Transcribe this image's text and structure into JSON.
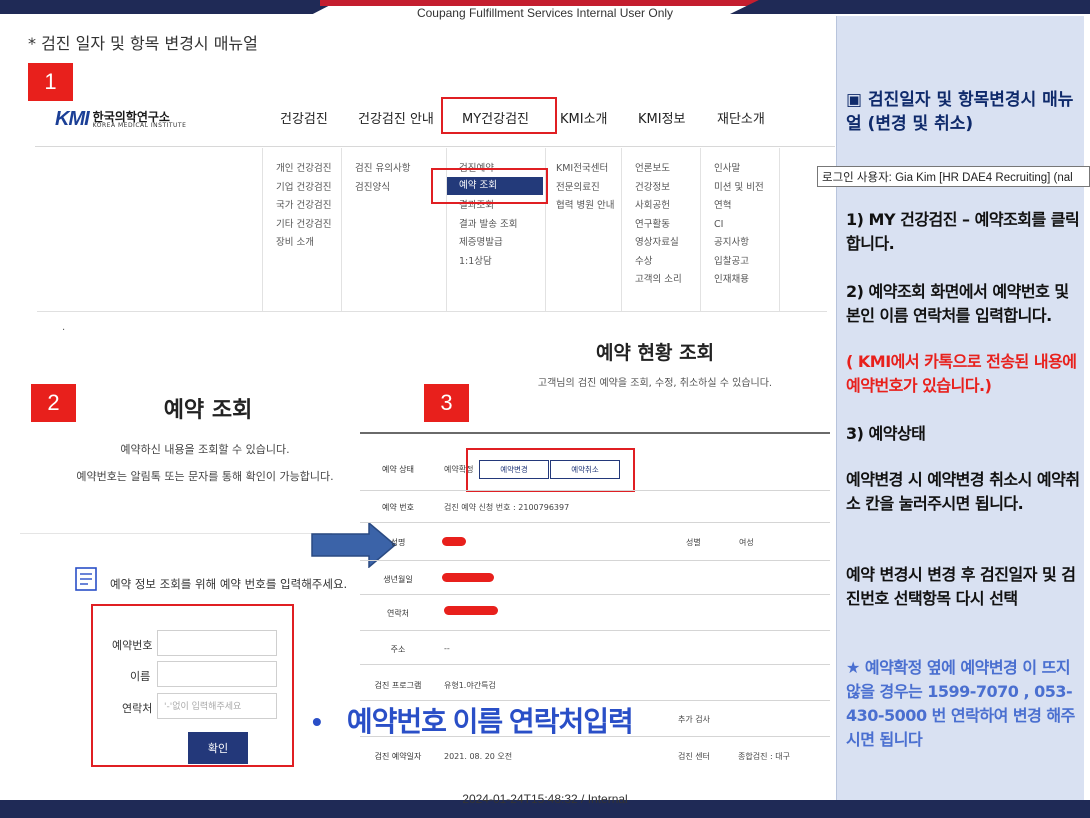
{
  "header": {
    "note": "Coupang Fulfillment Services Internal User Only",
    "title": "* 검진 일자 및 항목 변경시 매뉴얼"
  },
  "footer": {
    "stamp": "2024-01-24T15:48:32 / Internal"
  },
  "badges": [
    "1",
    "2",
    "3"
  ],
  "site": {
    "logo_mark": "KMI",
    "logo_ko": "한국의학연구소",
    "logo_en": "KOREA MEDICAL INSTITUTE",
    "nav": [
      "건강검진",
      "건강검진 안내",
      "MY건강검진",
      "KMI소개",
      "KMI정보",
      "재단소개"
    ],
    "submenu": [
      [
        "개인 건강검진",
        "기업 건강검진",
        "국가 건강검진",
        "기타 건강검진",
        "장비 소개"
      ],
      [
        "검진 유의사항",
        "검진양식"
      ],
      [
        "검진예약",
        "예약 조회",
        "결과조회",
        "결과 발송 조회",
        "제증명발급",
        "1:1상담"
      ],
      [
        "KMI전국센터",
        "전문의료진",
        "협력 병원 안내"
      ],
      [
        "언론보도",
        "건강정보",
        "사회공헌",
        "연구활동",
        "영상자료실",
        "수상",
        "고객의 소리"
      ],
      [
        "인사말",
        "미션 및 비전",
        "연혁",
        "CI",
        "공지사항",
        "입찰공고",
        "인재채용"
      ]
    ],
    "small_dot": "."
  },
  "reservation_lookup": {
    "title": "예약 조회",
    "sub1": "예약하신 내용을 조회할 수 있습니다.",
    "sub2": "예약번호는 알림톡 또는 문자를 통해 확인이 가능합니다.",
    "guide": "예약 정보 조회를 위해 예약 번호를 입력해주세요.",
    "fields": [
      {
        "label": "예약번호",
        "placeholder": ""
      },
      {
        "label": "이름",
        "placeholder": ""
      },
      {
        "label": "연락처",
        "placeholder": "'-'없이 입력해주세요"
      }
    ],
    "confirm_label": "확인"
  },
  "status_lookup": {
    "title": "예약 현황 조회",
    "subtitle": "고객님의 검진 예약을 조회, 수정, 취소하실 수 있습니다.",
    "rows": {
      "status_label": "예약 상태",
      "status_value": "예약확정",
      "change_btn": "예약변경",
      "cancel_btn": "예약취소",
      "number_label": "예약 번호",
      "number_value": "검진 예약 신청 번호 : 2100796397",
      "name_label": "성명",
      "gender_label": "성별",
      "gender_value": "여성",
      "birth_label": "생년월일",
      "phone_label": "연락처",
      "address_label": "주소",
      "address_value": "--",
      "program_label": "검진 프로그램",
      "program_value": "유형1.야간특검",
      "extra_label": "추가 검사",
      "date_label": "검진 예약일자",
      "date_value": "2021. 08. 20 오전",
      "center_label": "검진 센터",
      "center_value": "종합검진 : 대구"
    }
  },
  "caption": {
    "bullet": "•",
    "text": "예약번호 이름 연락처입력"
  },
  "right_panel": {
    "title": "▣ 검진일자 및 항목변경시 매뉴얼 (변경 및 취소)",
    "login_tooltip": "로그인 사용자: Gia Kim [HR DAE4 Recruiting] (nal",
    "step1": "1)  MY 건강검진 – 예약조회를 클릭합니다.",
    "step2": "2) 예약조회 화면에서 예약번호 및  본인 이름 연락처를  입력합니다.",
    "step2_note": "( KMI에서 카톡으로 전송된 내용에 예약번호가 있습니다.)",
    "step3": "3)  예약상태",
    "step3_a": "예약변경 시 예약변경 취소시  예약취소 칸을 눌러주시면 됩니다.",
    "step3_b": "예약 변경시 변경 후 검진일자 및 검진번호 선택항목 다시 선택",
    "note": "★ 예약확정 옆에 예약변경 이 뜨지 않을 경우는 1599-7070 , 053-430-5000 번 연락하여 변경 해주시면 됩니다"
  },
  "colors": {
    "accent_red": "#e01f23",
    "navy": "#1f2a56",
    "button_blue": "#23387a",
    "panel_bg": "#d9e1f2",
    "caption_blue": "#2a4fc7"
  }
}
